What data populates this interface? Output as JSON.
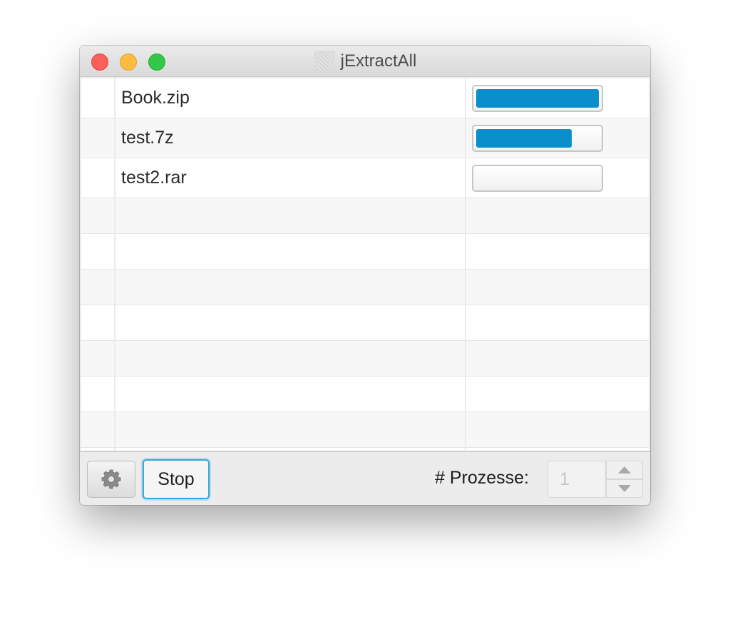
{
  "window": {
    "title": "jExtractAll",
    "app_icon": "archive-app-icon"
  },
  "table": {
    "columns": [
      "",
      "name",
      "progress"
    ],
    "rows": [
      {
        "name": "Book.zip",
        "progress": 1.0
      },
      {
        "name": "test.7z",
        "progress": 0.78
      },
      {
        "name": "test2.rar",
        "progress": 0.0
      }
    ]
  },
  "toolbar": {
    "settings_icon": "gear-icon",
    "stop_label": "Stop",
    "processes_label": "# Prozesse:",
    "processes_value": "1"
  },
  "colors": {
    "accent": "#0a8ecc",
    "focus": "#3aa6d8",
    "close": "#fc605c",
    "minimize": "#fdbc40",
    "maximize": "#34c84a"
  }
}
